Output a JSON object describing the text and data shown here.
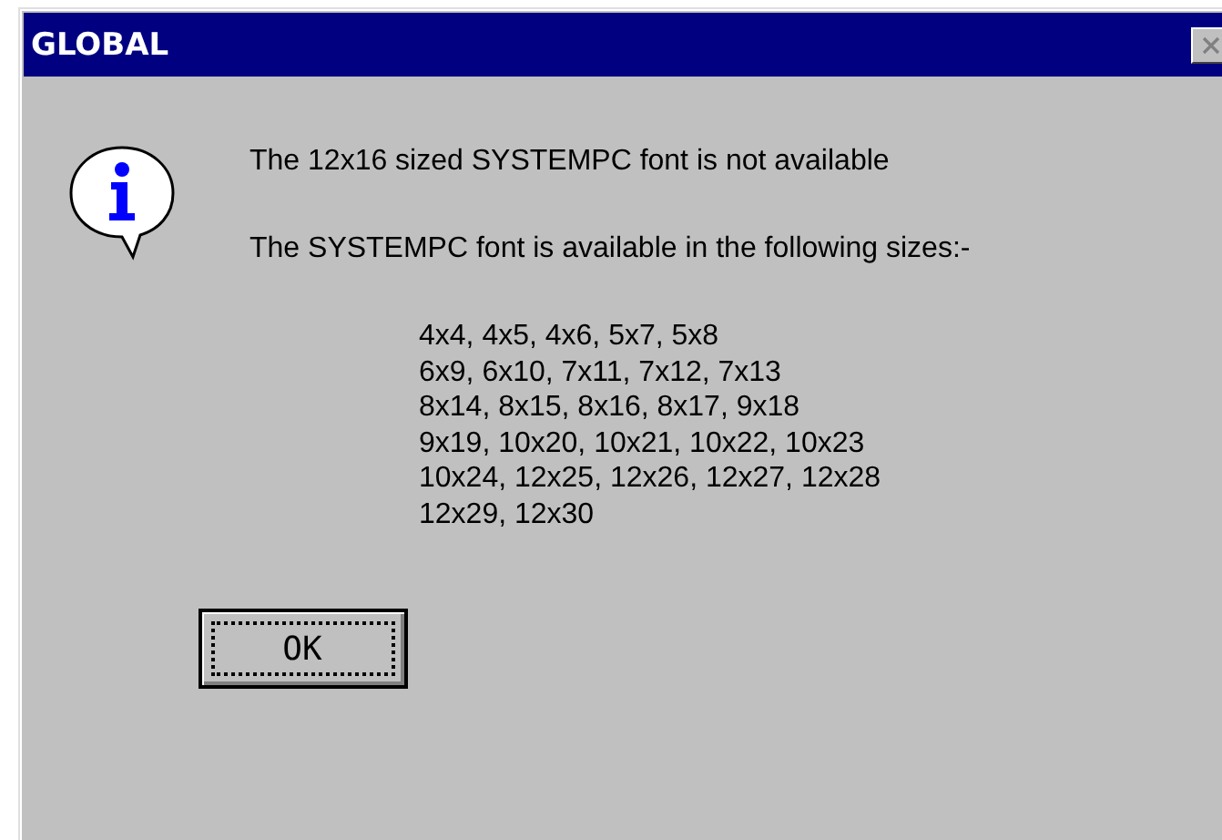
{
  "window": {
    "title": "GLOBAL"
  },
  "message": "The 12x16 sized SYSTEMPC font is not available",
  "detail": "The SYSTEMPC font is available in the following sizes:-",
  "sizes": [
    "4x4, 4x5, 4x6, 5x7, 5x8",
    "6x9, 6x10, 7x11, 7x12, 7x13",
    "8x14, 8x15, 8x16, 8x17, 9x18",
    "9x19, 10x20, 10x21, 10x22, 10x23",
    "10x24, 12x25, 12x26, 12x27, 12x28",
    "12x29, 12x30"
  ],
  "buttons": [
    {
      "label": "OK",
      "focused": true
    }
  ]
}
